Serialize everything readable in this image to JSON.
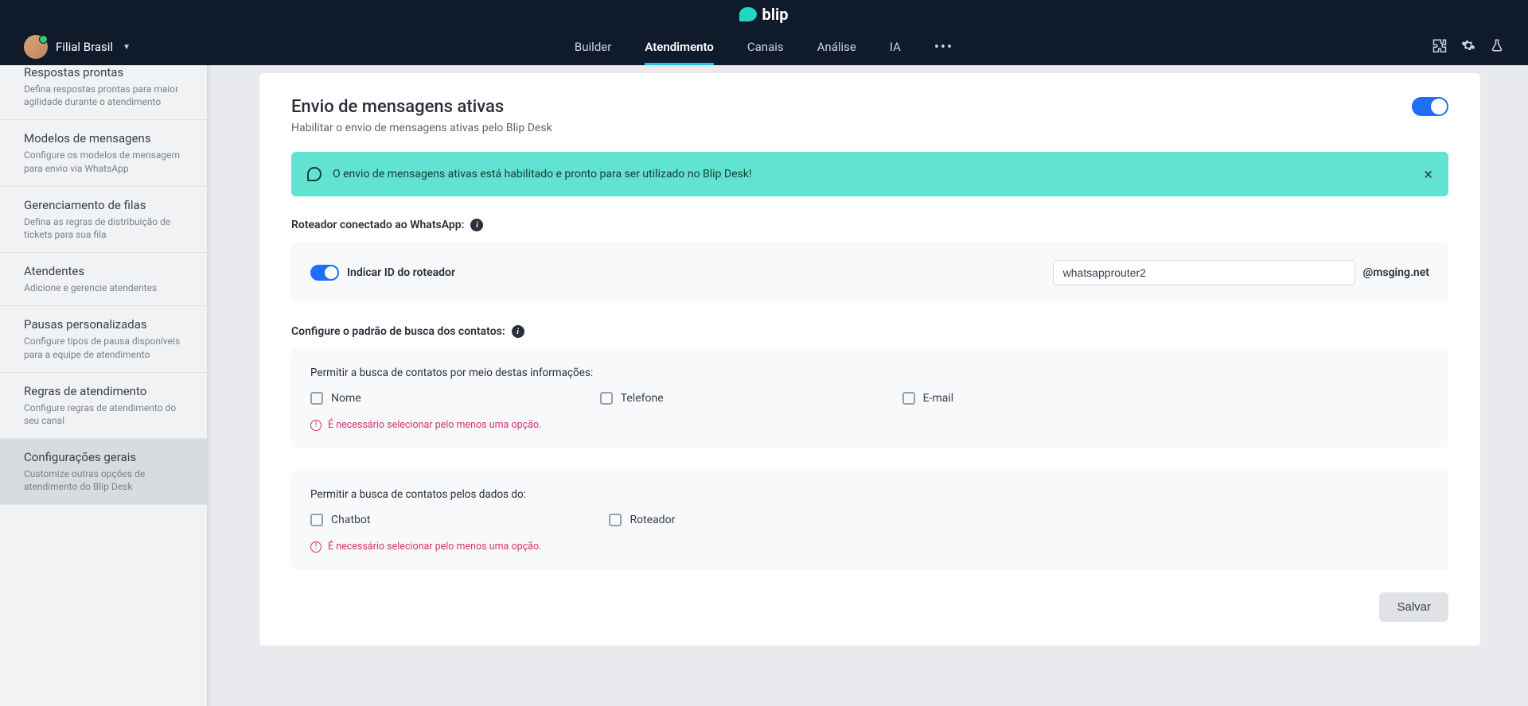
{
  "brand": {
    "name": "blip"
  },
  "project": {
    "name": "Filial Brasil"
  },
  "nav": {
    "items": [
      {
        "label": "Builder"
      },
      {
        "label": "Atendimento"
      },
      {
        "label": "Canais"
      },
      {
        "label": "Análise"
      },
      {
        "label": "IA"
      }
    ],
    "more": "•••"
  },
  "sidebar": [
    {
      "title": "Respostas prontas",
      "desc": "Defina respostas prontas para maior agilidade durante o atendimento"
    },
    {
      "title": "Modelos de mensagens",
      "desc": "Configure os modelos de mensagem para envio via WhatsApp"
    },
    {
      "title": "Gerenciamento de filas",
      "desc": "Defina as regras de distribuição de tickets para sua fila"
    },
    {
      "title": "Atendentes",
      "desc": "Adicione e gerencie atendentes"
    },
    {
      "title": "Pausas personalizadas",
      "desc": "Configure tipos de pausa disponíveis para a equipe de atendimento"
    },
    {
      "title": "Regras de atendimento",
      "desc": "Configure regras de atendimento do seu canal"
    },
    {
      "title": "Configurações gerais",
      "desc": "Customize outras opções de atendimento do Blip Desk"
    }
  ],
  "section": {
    "title": "Envio de mensagens ativas",
    "sub": "Habilitar o envio de mensagens ativas pelo Blip Desk"
  },
  "banner": {
    "text": "O envio de mensagens ativas está habilitado e pronto para ser utilizado no Blip Desk!"
  },
  "router": {
    "label": "Roteador conectado ao WhatsApp:",
    "toggle_label": "Indicar ID do roteador",
    "value": "whatsapprouter2",
    "suffix": "@msging.net"
  },
  "contacts": {
    "label": "Configure o padrão de busca dos contatos:"
  },
  "panel1": {
    "title": "Permitir a busca de contatos por meio destas informações:",
    "opts": [
      {
        "label": "Nome"
      },
      {
        "label": "Telefone"
      },
      {
        "label": "E-mail"
      }
    ],
    "error": "É necessário selecionar pelo menos uma opção."
  },
  "panel2": {
    "title": "Permitir a busca de contatos pelos dados do:",
    "opts": [
      {
        "label": "Chatbot"
      },
      {
        "label": "Roteador"
      }
    ],
    "error": "É necessário selecionar pelo menos uma opção."
  },
  "save": {
    "label": "Salvar"
  }
}
